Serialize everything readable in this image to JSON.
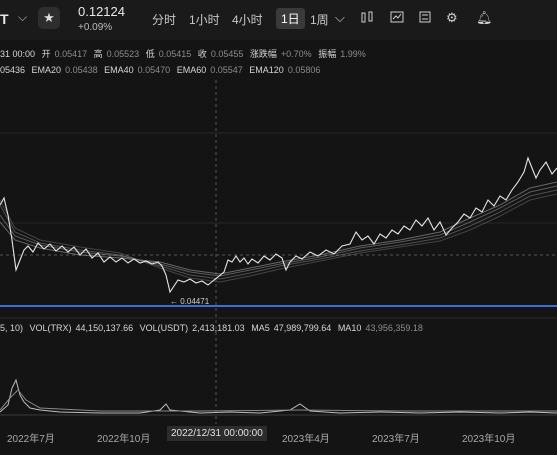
{
  "header": {
    "symbol": "T",
    "price": "0.12124",
    "change": "+0.09%",
    "timeframes": [
      "分时",
      "1小时",
      "4小时",
      "1日",
      "1周"
    ],
    "active_timeframe": "1日"
  },
  "ohlc": {
    "date": "31 00:00",
    "open_label": "开",
    "open": "0.05417",
    "high_label": "高",
    "high": "0.05523",
    "low_label": "低",
    "low": "0.05415",
    "close_label": "收",
    "close": "0.05455",
    "pct_label": "涨跌幅",
    "pct": "+0.70%",
    "amp_label": "振幅",
    "amp": "1.99%"
  },
  "ema": {
    "ema10_value": "05436",
    "ema20_label": "EMA20",
    "ema20": "0.05438",
    "ema40_label": "EMA40",
    "ema40": "0.05470",
    "ema60_label": "EMA60",
    "ema60": "0.05547",
    "ema120_label": "EMA120",
    "ema120": "0.05806"
  },
  "low_marker": "← 0.04471",
  "volume": {
    "params": "5, 10)",
    "trx_label": "VOL(TRX)",
    "trx": "44,150,137.66",
    "usdt_label": "VOL(USDT)",
    "usdt": "2,413,181.03",
    "ma5_label": "MA5",
    "ma5": "47,989,799.64",
    "ma10_label": "MA10",
    "ma10": "43,956,359.18"
  },
  "x_axis": [
    "2022年7月",
    "2022年10月",
    "2023年4月",
    "2023年7月",
    "2023年10月"
  ],
  "crosshair_date": "2022/12/31 00:00:00",
  "colors": {
    "background": "#141414",
    "support_line": "#3a6fd8",
    "price_line": "#e0e0e0"
  },
  "icons": [
    "chevron-down-icon",
    "star-icon",
    "indicator-icon",
    "drawing-icon",
    "settings-icon",
    "alert-icon"
  ]
}
